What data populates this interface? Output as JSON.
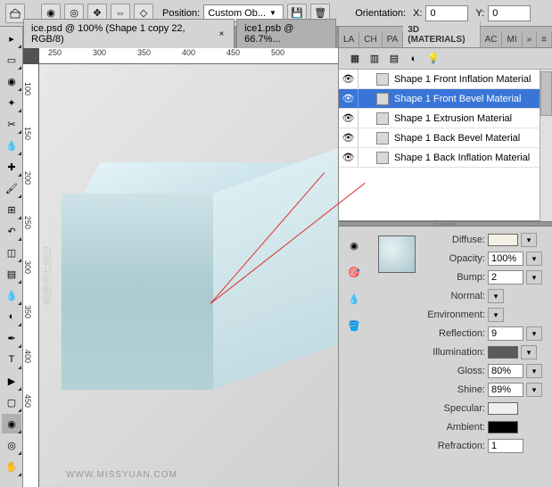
{
  "topbar": {
    "position_label": "Position:",
    "position_dropdown": "Custom Ob...",
    "orientation_label": "Orientation:",
    "x_label": "X:",
    "x_value": "0",
    "y_label": "Y:",
    "y_value": "0"
  },
  "documents": {
    "tabs": [
      {
        "title": "ice.psd @ 100% (Shape 1 copy 22, RGB/8)",
        "active": true
      },
      {
        "title": "ice1.psb @ 66.7%...",
        "active": false
      }
    ]
  },
  "ruler": {
    "h_ticks": [
      "250",
      "300",
      "350",
      "400",
      "450",
      "500"
    ],
    "v_ticks": [
      "100",
      "150",
      "200",
      "250",
      "300",
      "350",
      "400",
      "450"
    ]
  },
  "canvas": {
    "side_text": "思维设计论坛",
    "watermark": "WWW.MISSYUAN.COM"
  },
  "panels": {
    "tabs": [
      "LA",
      "CH",
      "PA",
      "3D (MATERIALS)",
      "AC",
      "MI"
    ],
    "active_index": 3
  },
  "materials": [
    {
      "name": "Shape 1 Front Inflation Material",
      "visible": true,
      "selected": false
    },
    {
      "name": "Shape 1 Front Bevel Material",
      "visible": true,
      "selected": true
    },
    {
      "name": "Shape 1 Extrusion Material",
      "visible": true,
      "selected": false
    },
    {
      "name": "Shape 1 Back Bevel Material",
      "visible": true,
      "selected": false
    },
    {
      "name": "Shape 1 Back Inflation Material",
      "visible": true,
      "selected": false
    }
  ],
  "properties": {
    "diffuse": {
      "label": "Diffuse:",
      "color": "#f5f0e6"
    },
    "opacity": {
      "label": "Opacity:",
      "value": "100%"
    },
    "bump": {
      "label": "Bump:",
      "value": "2"
    },
    "normal": {
      "label": "Normal:"
    },
    "environment": {
      "label": "Environment:"
    },
    "reflection": {
      "label": "Reflection:",
      "value": "9"
    },
    "illumination": {
      "label": "Illumination:",
      "color": "#5a5a5a"
    },
    "gloss": {
      "label": "Gloss:",
      "value": "80%"
    },
    "shine": {
      "label": "Shine:",
      "value": "89%"
    },
    "specular": {
      "label": "Specular:",
      "color": "#f0f0f0"
    },
    "ambient": {
      "label": "Ambient:",
      "color": "#000000"
    },
    "refraction": {
      "label": "Refraction:",
      "value": "1"
    }
  }
}
